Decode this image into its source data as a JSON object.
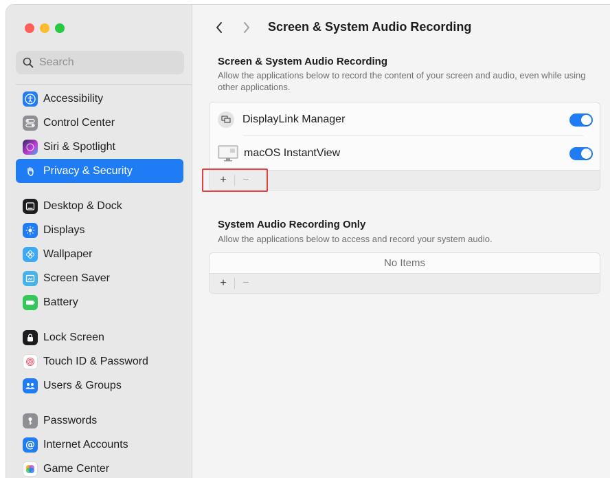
{
  "window": {
    "traffic_lights": {
      "close": "#fe5f57",
      "minimize": "#febc2e",
      "maximize": "#28c840"
    }
  },
  "sidebar": {
    "search_placeholder": "Search",
    "items": [
      {
        "label": "Accessibility",
        "icon": "accessibility-icon",
        "color": "#1f7cf4"
      },
      {
        "label": "Control Center",
        "icon": "control-center-icon",
        "color": "#8e8e93"
      },
      {
        "label": "Siri & Spotlight",
        "icon": "siri-icon",
        "color": "#6a3bd6"
      },
      {
        "label": "Privacy & Security",
        "icon": "hand-icon",
        "color": "#1f7cf4",
        "active": true
      },
      {
        "label": "Desktop & Dock",
        "icon": "dock-icon",
        "color": "#1d1d1f"
      },
      {
        "label": "Displays",
        "icon": "brightness-icon",
        "color": "#1f7cf4"
      },
      {
        "label": "Wallpaper",
        "icon": "wallpaper-icon",
        "color": "#3ba9f5"
      },
      {
        "label": "Screen Saver",
        "icon": "screen-saver-icon",
        "color": "#49b2e8"
      },
      {
        "label": "Battery",
        "icon": "battery-icon",
        "color": "#34c759"
      },
      {
        "label": "Lock Screen",
        "icon": "lock-icon",
        "color": "#1d1d1f"
      },
      {
        "label": "Touch ID & Password",
        "icon": "fingerprint-icon",
        "color": "#ff5b6e"
      },
      {
        "label": "Users & Groups",
        "icon": "users-icon",
        "color": "#1f7cf4"
      },
      {
        "label": "Passwords",
        "icon": "key-icon",
        "color": "#8e8e93"
      },
      {
        "label": "Internet Accounts",
        "icon": "at-icon",
        "color": "#1f7cf4"
      },
      {
        "label": "Game Center",
        "icon": "game-center-icon",
        "color": "#ff9f0a"
      }
    ]
  },
  "main": {
    "page_title": "Screen & System Audio Recording",
    "accent": "#1f7cf4",
    "screen_section": {
      "title": "Screen & System Audio Recording",
      "description": "Allow the applications below to record the content of your screen and audio, even while using other applications.",
      "apps": [
        {
          "label": "DisplayLink Manager",
          "enabled": true
        },
        {
          "label": "macOS InstantView",
          "enabled": true
        }
      ],
      "add_label": "+",
      "remove_label": "−"
    },
    "audio_section": {
      "title": "System Audio Recording Only",
      "description": "Allow the applications below to access and record your system audio.",
      "empty_label": "No Items",
      "add_label": "+",
      "remove_label": "−"
    }
  }
}
